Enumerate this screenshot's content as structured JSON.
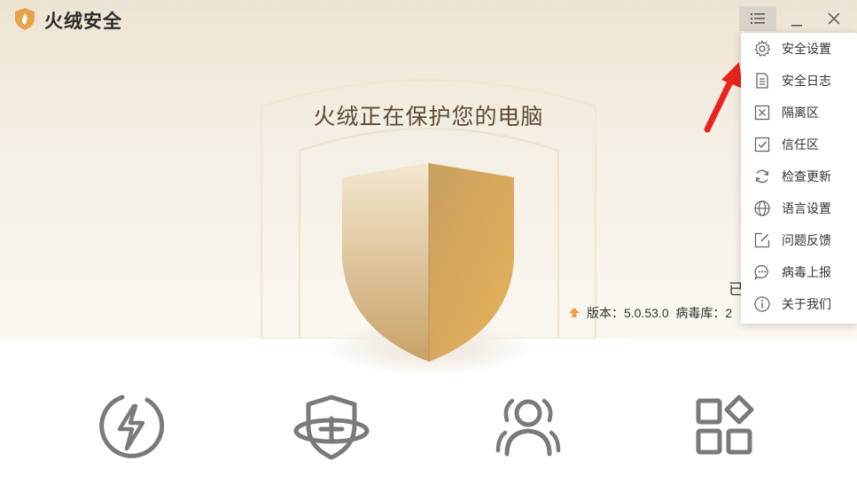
{
  "app": {
    "title": "火绒安全",
    "logo_icon": "flame-logo-icon",
    "accent_color": "#e8a24a"
  },
  "window_controls": {
    "menu_icon": "list-menu-icon",
    "minimize_icon": "minimize-icon",
    "close_icon": "close-icon"
  },
  "main": {
    "headline": "火绒正在保护您的电脑",
    "status_text_partial": "已",
    "version_text": "版本：5.0.53.0",
    "virus_db_text": "病毒库：2"
  },
  "dropdown_menu": {
    "items": [
      {
        "label": "安全设置",
        "icon": "gear-icon"
      },
      {
        "label": "安全日志",
        "icon": "document-icon"
      },
      {
        "label": "隔离区",
        "icon": "quarantine-box-icon"
      },
      {
        "label": "信任区",
        "icon": "check-box-icon"
      },
      {
        "label": "检查更新",
        "icon": "refresh-icon"
      },
      {
        "label": "语言设置",
        "icon": "globe-icon"
      },
      {
        "label": "问题反馈",
        "icon": "edit-icon"
      },
      {
        "label": "病毒上报",
        "icon": "chat-bubble-icon"
      },
      {
        "label": "关于我们",
        "icon": "info-icon"
      }
    ]
  },
  "features": [
    {
      "icon": "lightning-circle-icon"
    },
    {
      "icon": "shield-plus-icon"
    },
    {
      "icon": "users-icon"
    },
    {
      "icon": "apps-grid-icon"
    }
  ],
  "annotation": {
    "arrow_color": "#e8241c"
  }
}
